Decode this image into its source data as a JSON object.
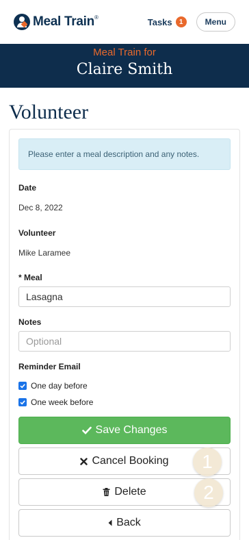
{
  "header": {
    "logo_text": "Meal Train",
    "logo_registered": "®",
    "tasks_label": "Tasks",
    "tasks_count": "1",
    "menu_label": "Menu"
  },
  "banner": {
    "subtitle": "Meal Train for",
    "recipient_name": "Claire Smith"
  },
  "page": {
    "title": "Volunteer"
  },
  "form": {
    "alert": "Please enter a meal description and any notes.",
    "date_label": "Date",
    "date_value": "Dec 8, 2022",
    "volunteer_label": "Volunteer",
    "volunteer_value": "Mike Laramee",
    "meal_label": "* Meal",
    "meal_value": "Lasagna",
    "notes_label": "Notes",
    "notes_placeholder": "Optional",
    "reminder_label": "Reminder Email",
    "reminder_options": [
      {
        "label": "One day before",
        "checked": true
      },
      {
        "label": "One week before",
        "checked": true
      }
    ]
  },
  "actions": {
    "save_label": "Save Changes",
    "cancel_label": "Cancel Booking",
    "delete_label": "Delete",
    "back_label": "Back",
    "step_badges": [
      "1",
      "2"
    ]
  },
  "colors": {
    "brand_navy": "#0e2d4c",
    "brand_orange": "#e9692c",
    "save_green": "#5cb85c",
    "alert_bg": "#d9eef6"
  }
}
